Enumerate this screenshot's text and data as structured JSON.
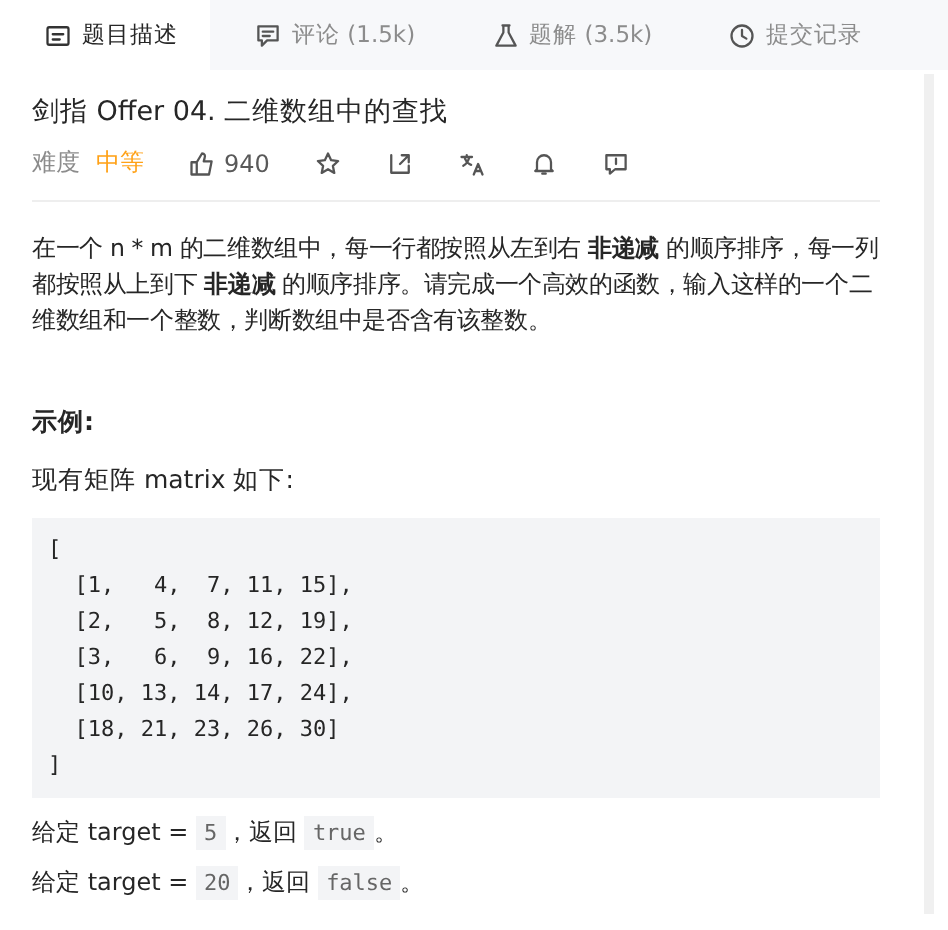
{
  "tabs": [
    {
      "label": "题目描述",
      "selected": true
    },
    {
      "label": "评论 (1.5k)",
      "selected": false
    },
    {
      "label": "题解 (3.5k)",
      "selected": false
    },
    {
      "label": "提交记录",
      "selected": false
    }
  ],
  "problem": {
    "title": "剑指 Offer 04. 二维数组中的查找",
    "difficulty_label": "难度",
    "difficulty": "中等",
    "likes": "940"
  },
  "description": "在一个 n * m 的二维数组中，每一行都按照从左到右 **非递减** 的顺序排序，每一列都按照从上到下 **非递减** 的顺序排序。请完成一个高效的函数，输入这样的一个二维数组和一个整数，判断数组中是否含有该整数。",
  "example_heading": "示例:",
  "example_intro": "现有矩阵 matrix 如下:",
  "code_lines": [
    "[",
    "  [1,   4,  7, 11, 15],",
    "  [2,   5,  8, 12, 19],",
    "  [3,   6,  9, 16, 22],",
    "  [10, 13, 14, 17, 24],",
    "  [18, 21, 23, 26, 30]",
    "]"
  ],
  "results": [
    [
      {
        "kind": "text",
        "text": "给定 target = "
      },
      {
        "kind": "code",
        "text": "5"
      },
      {
        "kind": "text",
        "text": "，返回 "
      },
      {
        "kind": "code",
        "text": "true"
      },
      {
        "kind": "text",
        "text": "。"
      }
    ],
    [
      {
        "kind": "text",
        "text": "给定 target = "
      },
      {
        "kind": "code",
        "text": "20"
      },
      {
        "kind": "text",
        "text": "，返回 "
      },
      {
        "kind": "code",
        "text": "false"
      },
      {
        "kind": "text",
        "text": "。"
      }
    ]
  ]
}
